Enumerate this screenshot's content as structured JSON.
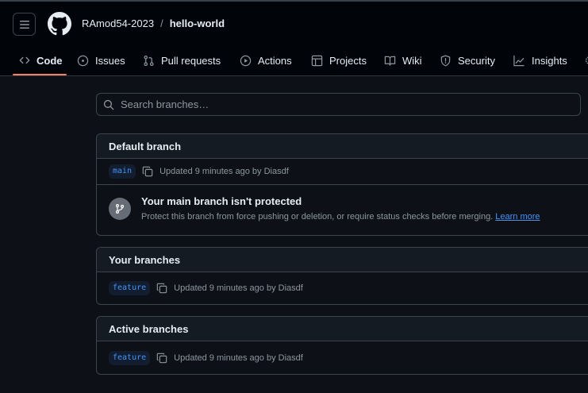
{
  "header": {
    "owner": "RAmod54-2023",
    "separator": "/",
    "repo": "hello-world"
  },
  "tabs": [
    {
      "label": "Code",
      "icon": "code-icon",
      "active": true
    },
    {
      "label": "Issues",
      "icon": "issue-opened-icon"
    },
    {
      "label": "Pull requests",
      "icon": "git-pull-request-icon"
    },
    {
      "label": "Actions",
      "icon": "play-icon"
    },
    {
      "label": "Projects",
      "icon": "table-icon"
    },
    {
      "label": "Wiki",
      "icon": "book-icon"
    },
    {
      "label": "Security",
      "icon": "shield-icon"
    },
    {
      "label": "Insights",
      "icon": "graph-icon"
    }
  ],
  "search": {
    "placeholder": "Search branches…"
  },
  "default_branch": {
    "heading": "Default branch",
    "name": "main",
    "updated": "Updated 9 minutes ago by Diasdf",
    "protect_title": "Your main branch isn't protected",
    "protect_desc": "Protect this branch from force pushing or deletion, or require status checks before merging.",
    "learn_more": "Learn more"
  },
  "your_branches": {
    "heading": "Your branches",
    "name": "feature",
    "updated": "Updated 9 minutes ago by Diasdf"
  },
  "active_branches": {
    "heading": "Active branches",
    "name": "feature",
    "updated": "Updated 9 minutes ago by Diasdf"
  },
  "colors": {
    "accent_underline": "#f78166",
    "link": "#4493f8",
    "background": "#0d1117"
  }
}
